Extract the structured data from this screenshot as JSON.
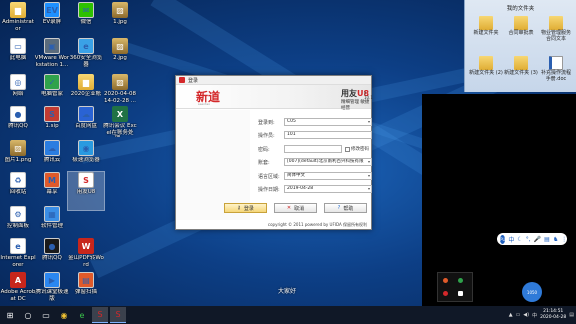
{
  "desktop_icons": [
    {
      "label": "Administrat or",
      "icon": "user-folder-icon",
      "kind": "folder"
    },
    {
      "label": "此电脑",
      "icon": "computer-icon",
      "kind": "doc"
    },
    {
      "label": "网络",
      "icon": "network-icon",
      "kind": "doc"
    },
    {
      "label": "腾讯QQ",
      "icon": "qq-icon",
      "kind": "doc"
    },
    {
      "label": "图片1.png",
      "icon": "image-file-icon",
      "kind": "img"
    },
    {
      "label": "回收站",
      "icon": "recycle-bin-icon",
      "kind": "doc"
    },
    {
      "label": "控制面板",
      "icon": "control-panel-icon",
      "kind": "doc"
    },
    {
      "label": "Internet Explorer",
      "icon": "ie-icon",
      "kind": "doc"
    },
    {
      "label": "Adobe Acrobat DC",
      "icon": "acrobat-icon",
      "kind": "pdf"
    },
    {
      "label": "EV录屏",
      "icon": "ev-recorder-icon",
      "kind": "doc"
    },
    {
      "label": "VMware Workstation 1...",
      "icon": "vmware-icon",
      "kind": "doc"
    },
    {
      "label": "电脑管家",
      "icon": "pc-manager-icon",
      "kind": "doc"
    },
    {
      "label": "1.sip",
      "icon": "sip-file-icon",
      "kind": "doc"
    },
    {
      "label": "腾讯云",
      "icon": "tencent-cloud-icon",
      "kind": "doc"
    },
    {
      "label": "幕享",
      "icon": "muxiang-icon",
      "kind": "doc"
    },
    {
      "label": "软件管理",
      "icon": "software-manager-icon",
      "kind": "doc"
    },
    {
      "label": "腾讯QQ",
      "icon": "qq-icon",
      "kind": "doc"
    },
    {
      "label": "腾讯课堂极速版",
      "icon": "tencent-classroom-icon",
      "kind": "doc"
    },
    {
      "label": "微信",
      "icon": "wechat-icon",
      "kind": "doc"
    },
    {
      "label": "360安全浏览器",
      "icon": "browser-360-icon",
      "kind": "doc"
    },
    {
      "label": "2020企业帐",
      "icon": "folder-icon",
      "kind": "folder"
    },
    {
      "label": "百度网盘",
      "icon": "baidu-netdisk-icon",
      "kind": "doc"
    },
    {
      "label": "极速浏览器",
      "icon": "fast-browser-icon",
      "kind": "doc"
    },
    {
      "label": "金山PDF转Word",
      "icon": "pdf-to-word-icon",
      "kind": "pdf"
    },
    {
      "label": "弹窗扫描",
      "icon": "scanner-icon",
      "kind": "doc"
    },
    {
      "label": "1.jpg",
      "icon": "jpg-file-icon",
      "kind": "img"
    },
    {
      "label": "2.jpg",
      "icon": "jpg-file-icon",
      "kind": "img"
    },
    {
      "label": "2020-04-08 14-02-28 ...",
      "icon": "screenshot-file-icon",
      "kind": "img"
    },
    {
      "label": "腾讯会议 Excel在账务处理...",
      "icon": "excel-file-icon",
      "kind": "excel"
    }
  ],
  "selected_icon": {
    "label": "用友U8",
    "icon": "u8-app-icon"
  },
  "folder_window": {
    "title": "我的文件夹",
    "items": [
      {
        "label": "新建文件夹",
        "icon": "folder-icon"
      },
      {
        "label": "合同审批表",
        "icon": "folder-icon"
      },
      {
        "label": "物业管理服务合同文本",
        "icon": "folder-icon"
      },
      {
        "label": "新建文件夹 (2)",
        "icon": "folder-icon"
      },
      {
        "label": "新建文件夹 (3)",
        "icon": "folder-icon"
      },
      {
        "label": "补充操作流程手册.doc",
        "icon": "word-doc-icon"
      }
    ]
  },
  "dialog": {
    "title": "登录",
    "brand_left": "新道",
    "brand_left_sub": "seentao",
    "brand_right": "用友",
    "brand_right_u": "U8",
    "version": "v 10.1",
    "slogan": "精细管理 敏捷经营",
    "fields": [
      {
        "label": "登录到:",
        "value": "C05",
        "type": "select"
      },
      {
        "label": "操作员:",
        "value": "101",
        "type": "text"
      },
      {
        "label": "密码:",
        "value": "",
        "type": "password"
      },
      {
        "label": "账套:",
        "value": "[007](default)北京南利百兴科技有限",
        "type": "select"
      },
      {
        "label": "语言区域:",
        "value": "简体中文",
        "type": "select"
      },
      {
        "label": "操作日期:",
        "value": "2019-04-28",
        "type": "select"
      }
    ],
    "change_password": "修改密码",
    "buttons": {
      "login": "登录",
      "cancel": "取消",
      "help": "帮助"
    },
    "copyright": "copyright © 2011 powered by UFIDA 保留所有权利"
  },
  "caption": "大家好",
  "ime": {
    "lang": "中",
    "badge": "PU"
  },
  "bubble": "1050",
  "taskbar": {
    "items": [
      "start-icon",
      "search-icon",
      "taskview-icon",
      "chrome-icon",
      "360-browser-icon",
      "u8-app-icon",
      "u8-login-icon"
    ],
    "time": "21:14:51",
    "date": "2020-04-28"
  }
}
